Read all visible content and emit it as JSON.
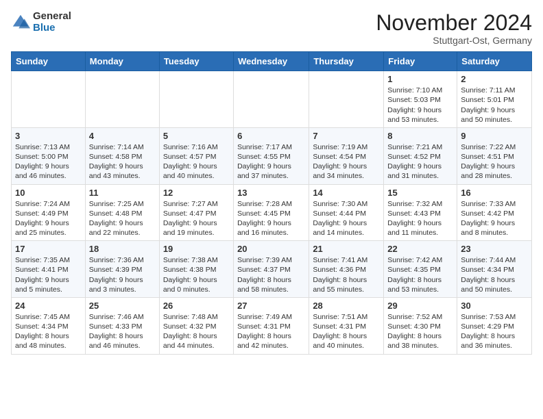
{
  "logo": {
    "general": "General",
    "blue": "Blue"
  },
  "title": "November 2024",
  "subtitle": "Stuttgart-Ost, Germany",
  "weekdays": [
    "Sunday",
    "Monday",
    "Tuesday",
    "Wednesday",
    "Thursday",
    "Friday",
    "Saturday"
  ],
  "weeks": [
    [
      {
        "day": "",
        "info": ""
      },
      {
        "day": "",
        "info": ""
      },
      {
        "day": "",
        "info": ""
      },
      {
        "day": "",
        "info": ""
      },
      {
        "day": "",
        "info": ""
      },
      {
        "day": "1",
        "info": "Sunrise: 7:10 AM\nSunset: 5:03 PM\nDaylight: 9 hours\nand 53 minutes."
      },
      {
        "day": "2",
        "info": "Sunrise: 7:11 AM\nSunset: 5:01 PM\nDaylight: 9 hours\nand 50 minutes."
      }
    ],
    [
      {
        "day": "3",
        "info": "Sunrise: 7:13 AM\nSunset: 5:00 PM\nDaylight: 9 hours\nand 46 minutes."
      },
      {
        "day": "4",
        "info": "Sunrise: 7:14 AM\nSunset: 4:58 PM\nDaylight: 9 hours\nand 43 minutes."
      },
      {
        "day": "5",
        "info": "Sunrise: 7:16 AM\nSunset: 4:57 PM\nDaylight: 9 hours\nand 40 minutes."
      },
      {
        "day": "6",
        "info": "Sunrise: 7:17 AM\nSunset: 4:55 PM\nDaylight: 9 hours\nand 37 minutes."
      },
      {
        "day": "7",
        "info": "Sunrise: 7:19 AM\nSunset: 4:54 PM\nDaylight: 9 hours\nand 34 minutes."
      },
      {
        "day": "8",
        "info": "Sunrise: 7:21 AM\nSunset: 4:52 PM\nDaylight: 9 hours\nand 31 minutes."
      },
      {
        "day": "9",
        "info": "Sunrise: 7:22 AM\nSunset: 4:51 PM\nDaylight: 9 hours\nand 28 minutes."
      }
    ],
    [
      {
        "day": "10",
        "info": "Sunrise: 7:24 AM\nSunset: 4:49 PM\nDaylight: 9 hours\nand 25 minutes."
      },
      {
        "day": "11",
        "info": "Sunrise: 7:25 AM\nSunset: 4:48 PM\nDaylight: 9 hours\nand 22 minutes."
      },
      {
        "day": "12",
        "info": "Sunrise: 7:27 AM\nSunset: 4:47 PM\nDaylight: 9 hours\nand 19 minutes."
      },
      {
        "day": "13",
        "info": "Sunrise: 7:28 AM\nSunset: 4:45 PM\nDaylight: 9 hours\nand 16 minutes."
      },
      {
        "day": "14",
        "info": "Sunrise: 7:30 AM\nSunset: 4:44 PM\nDaylight: 9 hours\nand 14 minutes."
      },
      {
        "day": "15",
        "info": "Sunrise: 7:32 AM\nSunset: 4:43 PM\nDaylight: 9 hours\nand 11 minutes."
      },
      {
        "day": "16",
        "info": "Sunrise: 7:33 AM\nSunset: 4:42 PM\nDaylight: 9 hours\nand 8 minutes."
      }
    ],
    [
      {
        "day": "17",
        "info": "Sunrise: 7:35 AM\nSunset: 4:41 PM\nDaylight: 9 hours\nand 5 minutes."
      },
      {
        "day": "18",
        "info": "Sunrise: 7:36 AM\nSunset: 4:39 PM\nDaylight: 9 hours\nand 3 minutes."
      },
      {
        "day": "19",
        "info": "Sunrise: 7:38 AM\nSunset: 4:38 PM\nDaylight: 9 hours\nand 0 minutes."
      },
      {
        "day": "20",
        "info": "Sunrise: 7:39 AM\nSunset: 4:37 PM\nDaylight: 8 hours\nand 58 minutes."
      },
      {
        "day": "21",
        "info": "Sunrise: 7:41 AM\nSunset: 4:36 PM\nDaylight: 8 hours\nand 55 minutes."
      },
      {
        "day": "22",
        "info": "Sunrise: 7:42 AM\nSunset: 4:35 PM\nDaylight: 8 hours\nand 53 minutes."
      },
      {
        "day": "23",
        "info": "Sunrise: 7:44 AM\nSunset: 4:34 PM\nDaylight: 8 hours\nand 50 minutes."
      }
    ],
    [
      {
        "day": "24",
        "info": "Sunrise: 7:45 AM\nSunset: 4:34 PM\nDaylight: 8 hours\nand 48 minutes."
      },
      {
        "day": "25",
        "info": "Sunrise: 7:46 AM\nSunset: 4:33 PM\nDaylight: 8 hours\nand 46 minutes."
      },
      {
        "day": "26",
        "info": "Sunrise: 7:48 AM\nSunset: 4:32 PM\nDaylight: 8 hours\nand 44 minutes."
      },
      {
        "day": "27",
        "info": "Sunrise: 7:49 AM\nSunset: 4:31 PM\nDaylight: 8 hours\nand 42 minutes."
      },
      {
        "day": "28",
        "info": "Sunrise: 7:51 AM\nSunset: 4:31 PM\nDaylight: 8 hours\nand 40 minutes."
      },
      {
        "day": "29",
        "info": "Sunrise: 7:52 AM\nSunset: 4:30 PM\nDaylight: 8 hours\nand 38 minutes."
      },
      {
        "day": "30",
        "info": "Sunrise: 7:53 AM\nSunset: 4:29 PM\nDaylight: 8 hours\nand 36 minutes."
      }
    ]
  ]
}
